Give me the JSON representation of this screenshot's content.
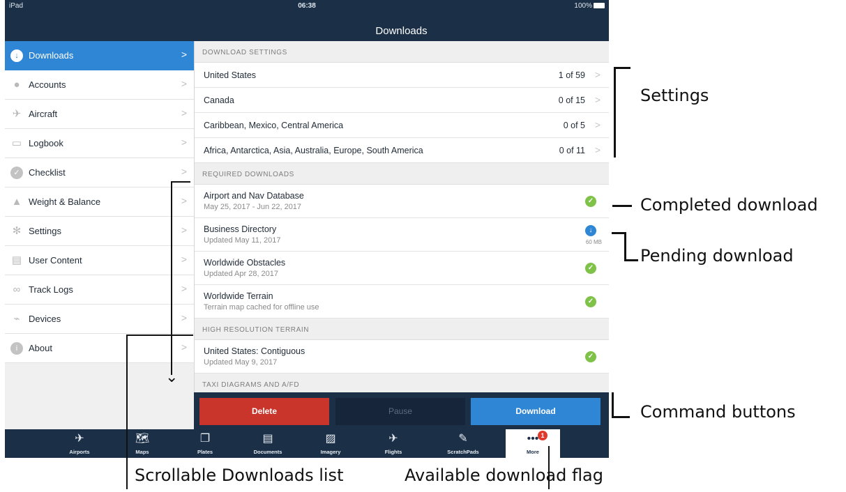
{
  "status_bar": {
    "device": "iPad",
    "time": "06:38",
    "battery": "100%"
  },
  "nav": {
    "title": "Downloads"
  },
  "sidebar": {
    "items": [
      {
        "label": "Downloads",
        "icon": "download-icon",
        "active": true
      },
      {
        "label": "Accounts",
        "icon": "person-icon"
      },
      {
        "label": "Aircraft",
        "icon": "airplane-icon"
      },
      {
        "label": "Logbook",
        "icon": "book-icon"
      },
      {
        "label": "Checklist",
        "icon": "checkmark-icon"
      },
      {
        "label": "Weight & Balance",
        "icon": "scale-icon"
      },
      {
        "label": "Settings",
        "icon": "gear-icon"
      },
      {
        "label": "User Content",
        "icon": "document-icon"
      },
      {
        "label": "Track Logs",
        "icon": "track-icon"
      },
      {
        "label": "Devices",
        "icon": "plug-icon"
      },
      {
        "label": "About",
        "icon": "info-icon"
      }
    ],
    "chevron": ">"
  },
  "main": {
    "download_settings": {
      "header": "DOWNLOAD SETTINGS",
      "rows": [
        {
          "label": "United States",
          "count": "1 of 59"
        },
        {
          "label": "Canada",
          "count": "0 of 15"
        },
        {
          "label": "Caribbean, Mexico, Central America",
          "count": "0 of 5"
        },
        {
          "label": "Africa, Antarctica, Asia, Australia, Europe, South America",
          "count": "0 of 11"
        }
      ]
    },
    "required_downloads": {
      "header": "REQUIRED DOWNLOADS",
      "rows": [
        {
          "title": "Airport and Nav Database",
          "subtitle": "May 25, 2017 - Jun 22, 2017",
          "state": "complete"
        },
        {
          "title": "Business Directory",
          "subtitle": "Updated May 11, 2017",
          "state": "pending",
          "size": "60 MB"
        },
        {
          "title": "Worldwide Obstacles",
          "subtitle": "Updated Apr 28, 2017",
          "state": "complete"
        },
        {
          "title": "Worldwide Terrain",
          "subtitle": "Terrain map cached for offline use",
          "state": "complete"
        }
      ]
    },
    "high_resolution_terrain": {
      "header": "HIGH RESOLUTION TERRAIN",
      "rows": [
        {
          "title": "United States: Contiguous",
          "subtitle": "Updated May 9, 2017",
          "state": "complete"
        }
      ]
    },
    "taxi_diagrams": {
      "header": "TAXI DIAGRAMS AND A/FD"
    }
  },
  "commands": {
    "delete": "Delete",
    "pause": "Pause",
    "download": "Download"
  },
  "tabbar": {
    "tabs": [
      {
        "label": "Airports",
        "icon": "airport-icon",
        "glyph": "✈"
      },
      {
        "label": "Maps",
        "icon": "map-icon",
        "glyph": "🗺"
      },
      {
        "label": "Plates",
        "icon": "plates-icon",
        "glyph": "❐"
      },
      {
        "label": "Documents",
        "icon": "documents-icon",
        "glyph": "▤"
      },
      {
        "label": "Imagery",
        "icon": "imagery-icon",
        "glyph": "▨"
      },
      {
        "label": "Flights",
        "icon": "flights-icon",
        "glyph": "✈"
      },
      {
        "label": "ScratchPads",
        "icon": "pen-icon",
        "glyph": "✎"
      },
      {
        "label": "More",
        "icon": "more-icon",
        "glyph": "•••",
        "badge": "1",
        "active": true
      }
    ]
  },
  "annotations": {
    "settings": "Settings",
    "completed_download": "Completed download",
    "pending_download": "Pending download",
    "command_buttons": "Command buttons",
    "scrollable_list": "Scrollable Downloads list",
    "available_flag": "Available download flag"
  },
  "colors": {
    "nav_bar": "#1b2f47",
    "accent": "#2f86d4",
    "delete": "#c9342b",
    "complete": "#7ec247",
    "badge": "#e03a2d"
  }
}
